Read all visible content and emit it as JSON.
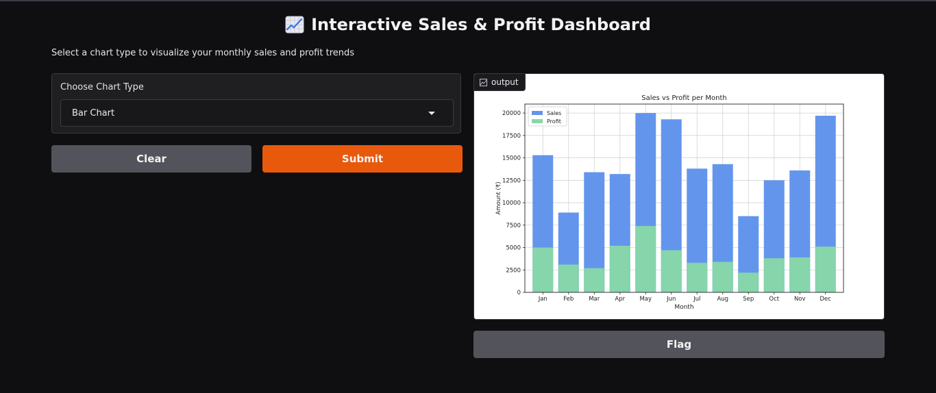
{
  "header": {
    "title_icon": "chart-increasing-icon",
    "title": "Interactive Sales & Profit Dashboard",
    "subtitle": "Select a chart type to visualize your monthly sales and profit trends"
  },
  "form": {
    "dropdown_label": "Choose Chart Type",
    "dropdown_value": "Bar Chart",
    "clear_label": "Clear",
    "submit_label": "Submit",
    "flag_label": "Flag"
  },
  "output": {
    "label": "output",
    "label_icon": "image-icon"
  },
  "colors": {
    "accent": "#e8590c",
    "sales": "#6495ed",
    "profit": "#88d8a8"
  },
  "chart_data": {
    "type": "bar",
    "stacked": "overlay",
    "title": "Sales vs Profit per Month",
    "xlabel": "Month",
    "ylabel": "Amount (₹)",
    "ylim": [
      0,
      21000
    ],
    "yticks": [
      0,
      2500,
      5000,
      7500,
      10000,
      12500,
      15000,
      17500,
      20000
    ],
    "categories": [
      "Jan",
      "Feb",
      "Mar",
      "Apr",
      "May",
      "Jun",
      "Jul",
      "Aug",
      "Sep",
      "Oct",
      "Nov",
      "Dec"
    ],
    "grid": true,
    "legend_position": "top-left",
    "series": [
      {
        "name": "Sales",
        "color": "#6495ed",
        "values": [
          15300,
          8900,
          13400,
          13200,
          20000,
          19300,
          13800,
          14300,
          8500,
          12500,
          13600,
          19700
        ]
      },
      {
        "name": "Profit",
        "color": "#88d8a8",
        "values": [
          5000,
          3100,
          2700,
          5200,
          7400,
          4700,
          3300,
          3400,
          2200,
          3800,
          3900,
          5100
        ]
      }
    ]
  }
}
